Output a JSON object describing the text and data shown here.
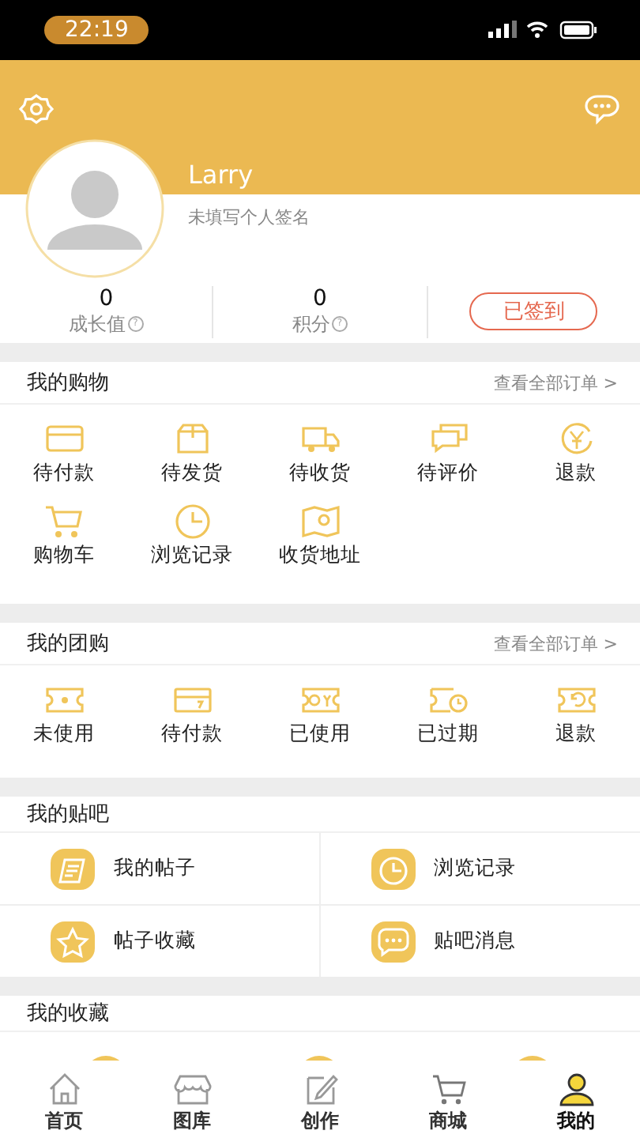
{
  "status_bar": {
    "time": "22:19"
  },
  "profile": {
    "name": "Larry",
    "signature": "未填写个人签名"
  },
  "stats": [
    {
      "value": "0",
      "label": "成长值",
      "help": "?"
    },
    {
      "value": "0",
      "label": "积分",
      "help": "?"
    }
  ],
  "checkin_button": "已签到",
  "shopping": {
    "title": "我的购物",
    "link": "查看全部订单",
    "link_arrow": ">",
    "items": [
      "待付款",
      "待发货",
      "待收货",
      "待评价",
      "退款",
      "购物车",
      "浏览记录",
      "收货地址"
    ]
  },
  "group_buy": {
    "title": "我的团购",
    "link": "查看全部订单",
    "link_arrow": ">",
    "items": [
      "未使用",
      "待付款",
      "已使用",
      "已过期",
      "退款"
    ]
  },
  "tieba": {
    "title": "我的贴吧",
    "items": [
      "我的帖子",
      "浏览记录",
      "帖子收藏",
      "贴吧消息"
    ]
  },
  "favorites": {
    "title": "我的收藏"
  },
  "tab_bar": [
    {
      "label": "首页",
      "selected": false
    },
    {
      "label": "图库",
      "selected": false
    },
    {
      "label": "创作",
      "selected": false
    },
    {
      "label": "商城",
      "selected": false
    },
    {
      "label": "我的",
      "selected": true
    }
  ]
}
